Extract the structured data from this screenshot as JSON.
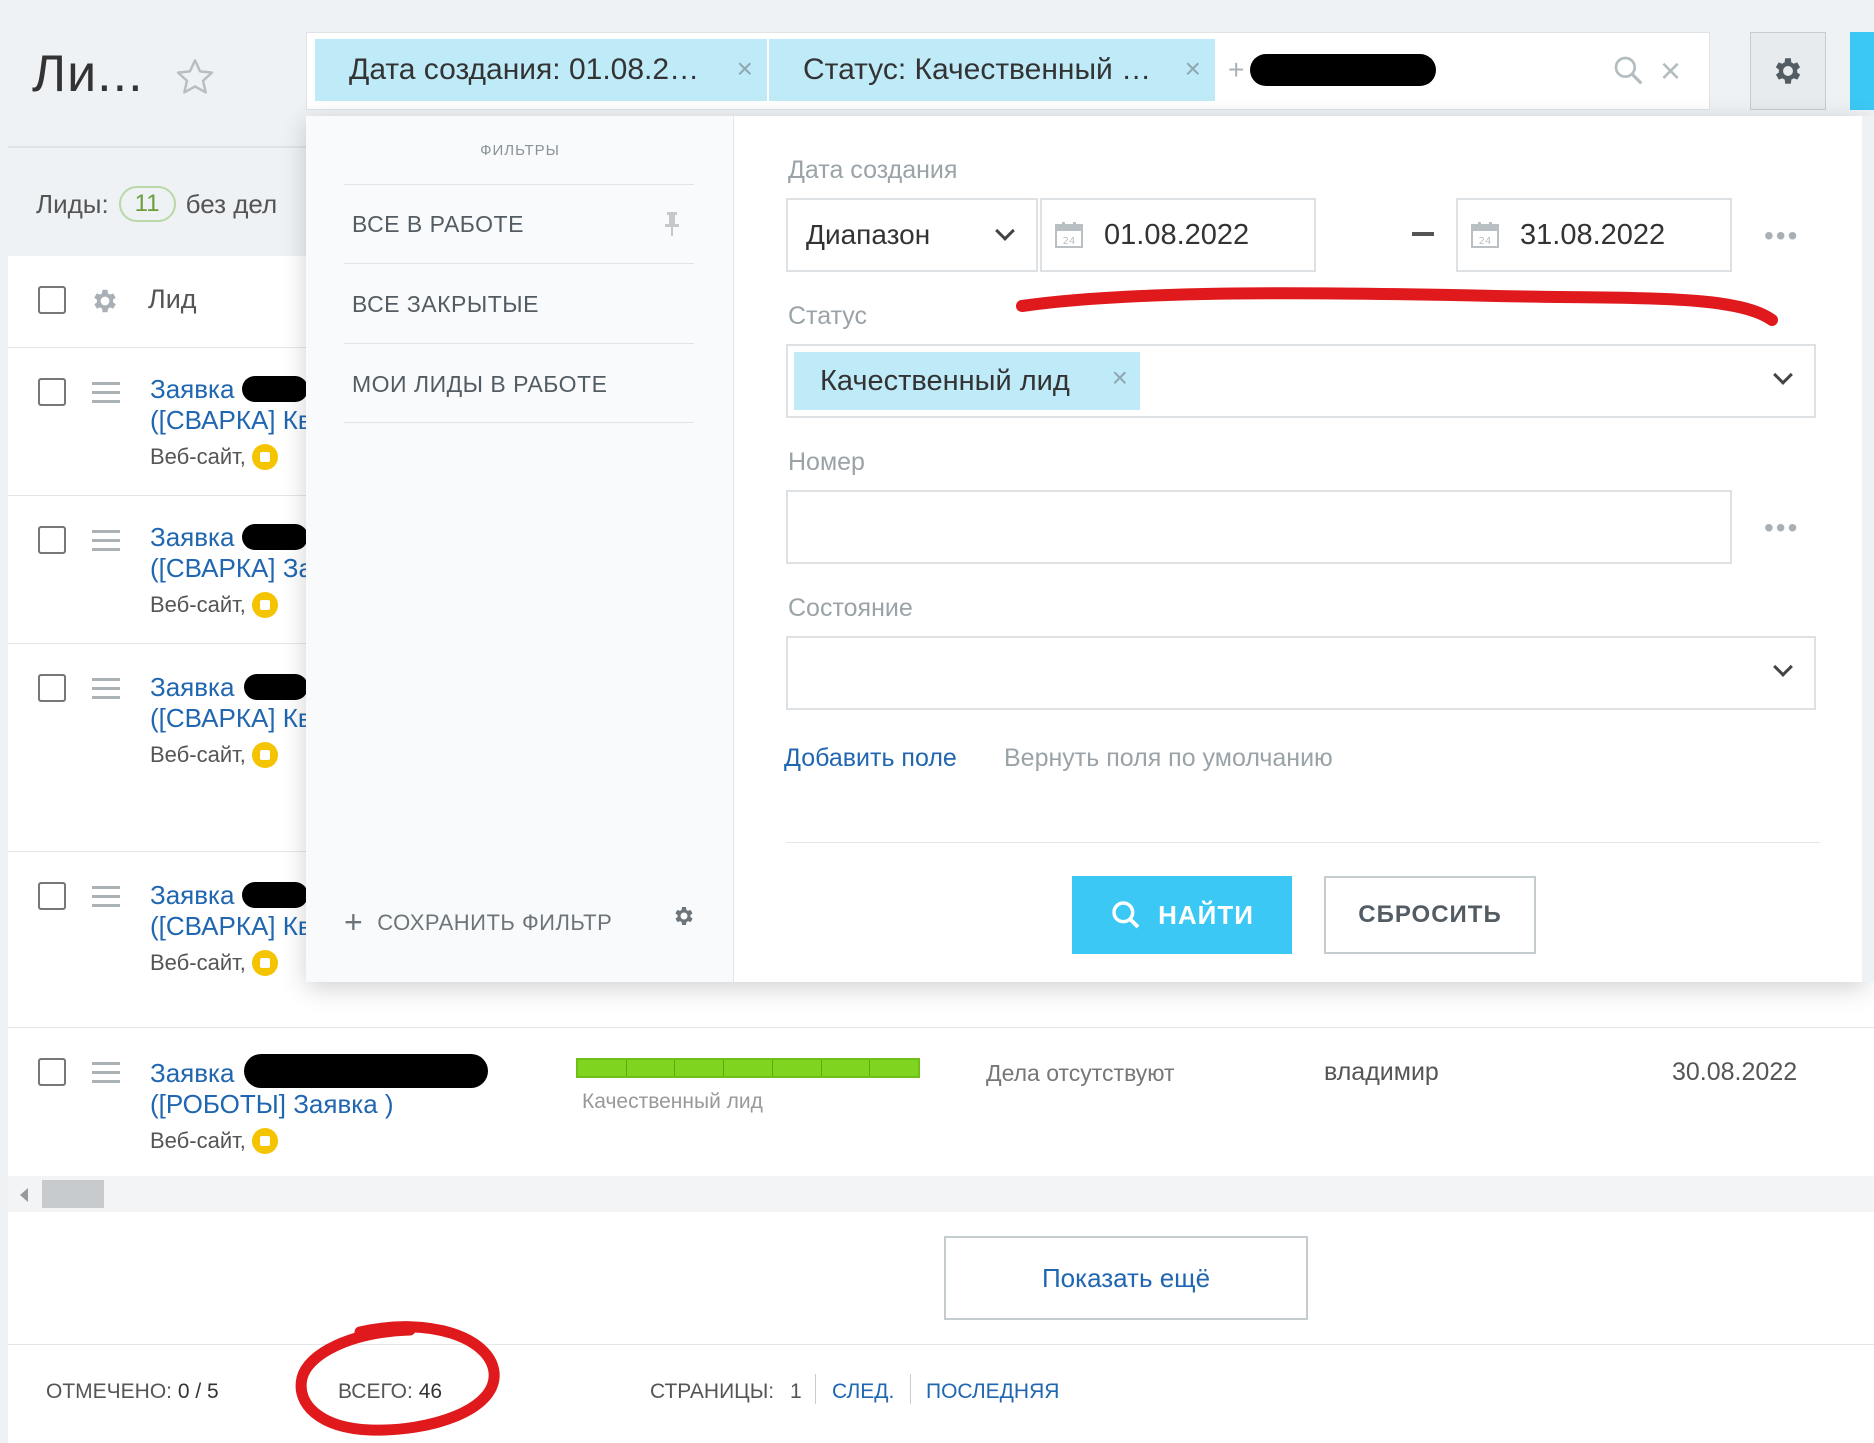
{
  "header": {
    "title": "Ли...",
    "filter_chips": [
      {
        "label": "Дата создания: 01.08.2…",
        "remove": "×"
      },
      {
        "label": "Статус: Качественный …",
        "remove": "×"
      }
    ],
    "add_symbol": "+",
    "clear_symbol": "×"
  },
  "summary": {
    "label": "Лиды:",
    "count": "11",
    "suffix": "без дел"
  },
  "table": {
    "header_label": "Лид",
    "rows": [
      {
        "title_1": "Заявка",
        "title_2": "([СВАРКА] Кв",
        "source": "Веб-сайт,"
      },
      {
        "title_1": "Заявка",
        "title_2": "([СВАРКА] За",
        "source": "Веб-сайт,"
      },
      {
        "title_1": "Заявка",
        "title_2": "([СВАРКА] Кв",
        "source": "Веб-сайт,"
      },
      {
        "title_1": "Заявка",
        "title_2": "([СВАРКА] Кв",
        "source": "Веб-сайт,"
      },
      {
        "title_1": "Заявка",
        "title_2": "([РОБОТЫ] Заявка )",
        "source": "Веб-сайт,",
        "stage": "Качественный лид",
        "stage_progress": 1.0,
        "deals": "Дела отсутствуют",
        "owner": "владимир",
        "date": "30.08.2022"
      }
    ]
  },
  "filter_panel": {
    "presets_heading": "ФИЛЬТРЫ",
    "presets": [
      "ВСЕ В РАБОТЕ",
      "ВСЕ ЗАКРЫТЫЕ",
      "МОИ ЛИДЫ В РАБОТЕ"
    ],
    "save_filter": "СОХРАНИТЬ ФИЛЬТР",
    "fields": {
      "created_label": "Дата создания",
      "range_value": "Диапазон",
      "date_from": "01.08.2022",
      "date_to": "31.08.2022",
      "calendar_day": "24",
      "status_label": "Статус",
      "status_chip": "Качественный лид",
      "number_label": "Номер",
      "state_label": "Состояние",
      "more": "•••"
    },
    "add_field": "Добавить поле",
    "reset_fields": "Вернуть поля по умолчанию",
    "find_button": "НАЙТИ",
    "reset_button": "СБРОСИТЬ"
  },
  "show_more": "Показать ещё",
  "footer": {
    "selected_label": "ОТМЕЧЕНО:",
    "selected_value": "0 / 5",
    "total_label": "ВСЕГО:",
    "total_value": "46",
    "pages_label": "СТРАНИЦЫ:",
    "page": "1",
    "next": "СЛЕД.",
    "last": "ПОСЛЕДНЯЯ"
  },
  "colors": {
    "accent": "#3bc8f5",
    "link": "#2066b0",
    "chip": "#bfeaf8",
    "progress": "#7fd41f",
    "annotation": "#e0191c",
    "badge": "#f5c400"
  }
}
